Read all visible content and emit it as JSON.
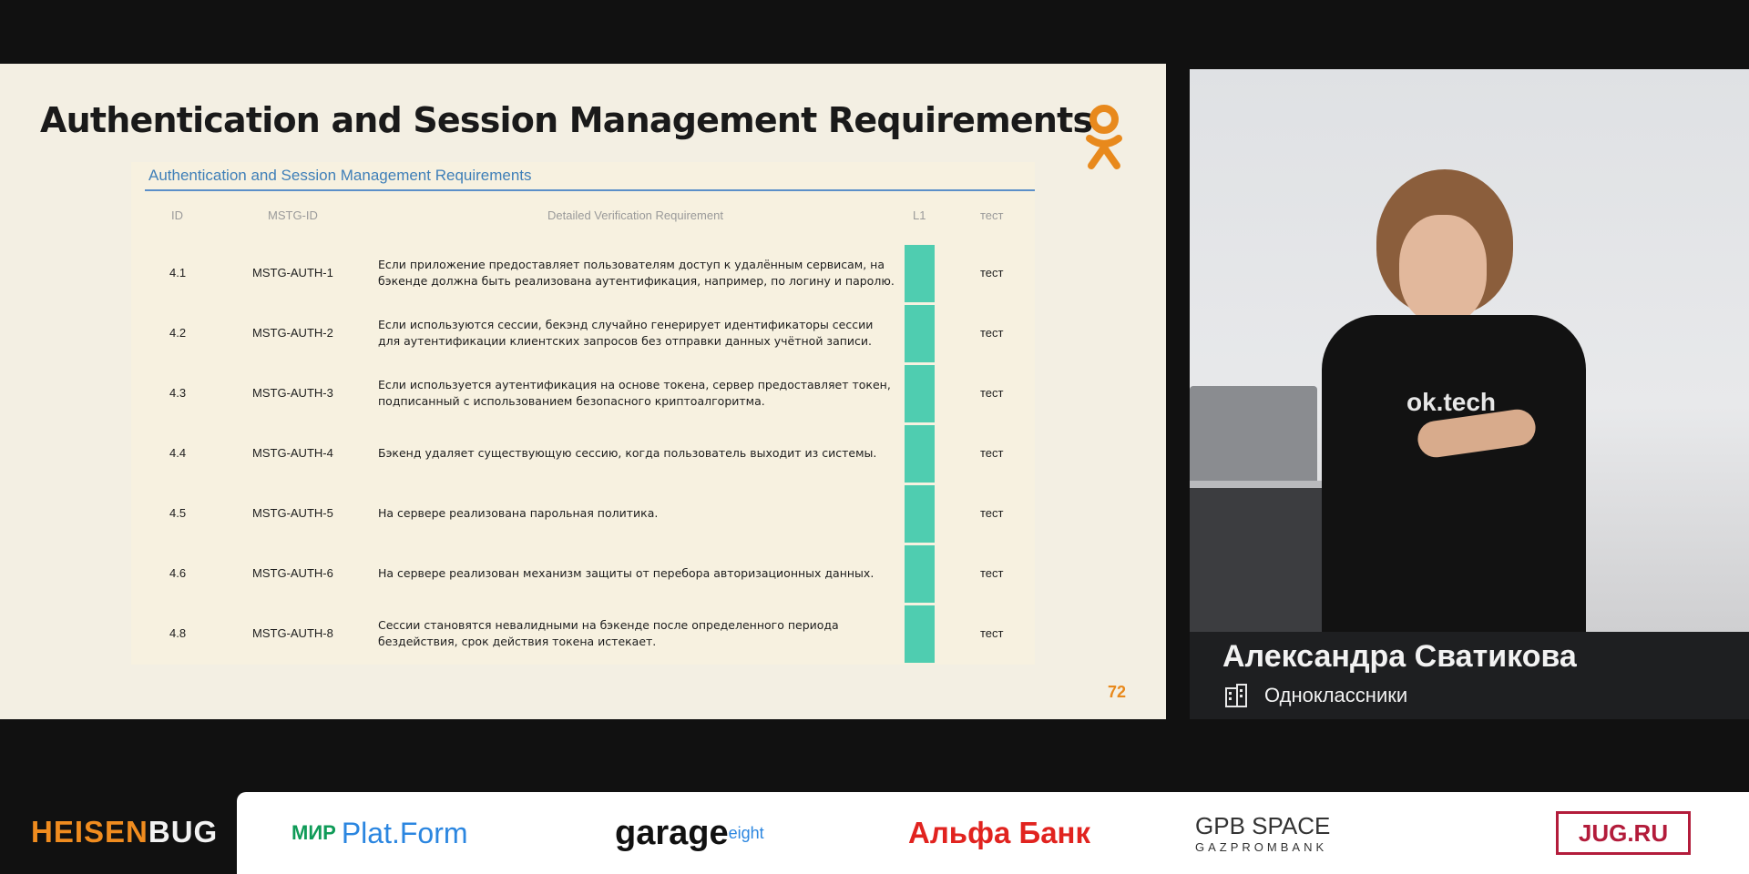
{
  "slide": {
    "title": "Authentication and Session Management Requirements",
    "table_heading": "Authentication and Session Management Requirements",
    "columns": [
      "ID",
      "MSTG-ID",
      "Detailed Verification Requirement",
      "L1",
      "тест"
    ],
    "rows": [
      {
        "id": "4.1",
        "mstg": "MSTG-AUTH-1",
        "req": "Если приложение предоставляет пользователям доступ к удалённым сервисам, на бэкенде должна быть реализована аутентификация, например, по логину и паролю.",
        "test": "тест"
      },
      {
        "id": "4.2",
        "mstg": "MSTG-AUTH-2",
        "req": "Если используются сессии, бекэнд случайно генерирует идентификаторы сессии для аутентификации клиентских запросов без отправки данных учётной записи.",
        "test": "тест"
      },
      {
        "id": "4.3",
        "mstg": "MSTG-AUTH-3",
        "req": "Если используется аутентификация на основе токена, сервер предоставляет токен, подписанный с использованием безопасного криптоалгоритма.",
        "test": "тест"
      },
      {
        "id": "4.4",
        "mstg": "MSTG-AUTH-4",
        "req": "Бэкенд удаляет существующую сессию, когда пользователь выходит из системы.",
        "test": "тест"
      },
      {
        "id": "4.5",
        "mstg": "MSTG-AUTH-5",
        "req": "На сервере реализована парольная политика.",
        "test": "тест"
      },
      {
        "id": "4.6",
        "mstg": "MSTG-AUTH-6",
        "req": "На сервере реализован механизм защиты от перебора авторизационных данных.",
        "test": "тест"
      },
      {
        "id": "4.8",
        "mstg": "MSTG-AUTH-8",
        "req": "Сессии становятся невалидными на бэкенде после определенного периода бездействия, срок действия токена истекает.",
        "test": "тест"
      }
    ],
    "page_number": "72",
    "logo_icon": "odnoklassniki-logo-icon",
    "accent_color": "#e8891c",
    "l1_color": "#4fcdb0"
  },
  "video": {
    "shirt_text": "ok.tech"
  },
  "caption": {
    "speaker_name": "Александра Сватикова",
    "company": "Одноклассники",
    "company_icon": "building-icon"
  },
  "footer": {
    "event_logo_a": "HEISEN",
    "event_logo_b": "BUG",
    "sponsors": [
      {
        "mark": "МИР",
        "name": "Plat.Form"
      },
      {
        "name": "garage",
        "sup": "eight"
      },
      {
        "name": "Альфа Банк"
      },
      {
        "name": "GPB SPACE",
        "sub": "GAZPROMBANK"
      },
      {
        "name": "JUG.RU"
      }
    ]
  }
}
